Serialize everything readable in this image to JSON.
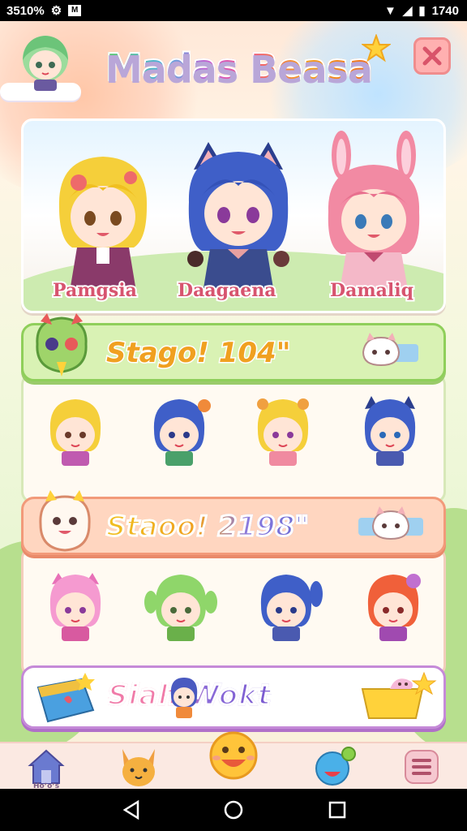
{
  "status_bar": {
    "time": "3510%",
    "right_time": "1740"
  },
  "header": {
    "title": "Madas Beasa"
  },
  "hero": {
    "characters": [
      {
        "name": "Pamgsia",
        "hair": "#f5cf3a"
      },
      {
        "name": "Daagaena",
        "hair": "#3f5fc8"
      },
      {
        "name": "Damaliq",
        "hair": "#f28aa3"
      }
    ]
  },
  "stages": [
    {
      "title": "Stago! 104\"",
      "header_color": "#d9f2b4",
      "title_color": "#f0a020",
      "characters": [
        "#f5cf3a",
        "#3f5fc8",
        "#f5cf3a",
        "#3f5fc8"
      ]
    },
    {
      "title": "Staoo! 2198\"",
      "header_color": "#ffd6c0",
      "title_color": "#f0b820",
      "characters": [
        "#f59ad0",
        "#8fd66a",
        "#3f5fc8",
        "#f0603a"
      ]
    }
  ],
  "banner": {
    "text": "Siah Wokt"
  },
  "bottom_nav": {
    "home_label": "Hoʼoʼs",
    "items": [
      "home",
      "fox",
      "smile",
      "face",
      "menu"
    ]
  },
  "colors": {
    "accent": "#f6a6c7",
    "panel": "#fffaf2"
  }
}
